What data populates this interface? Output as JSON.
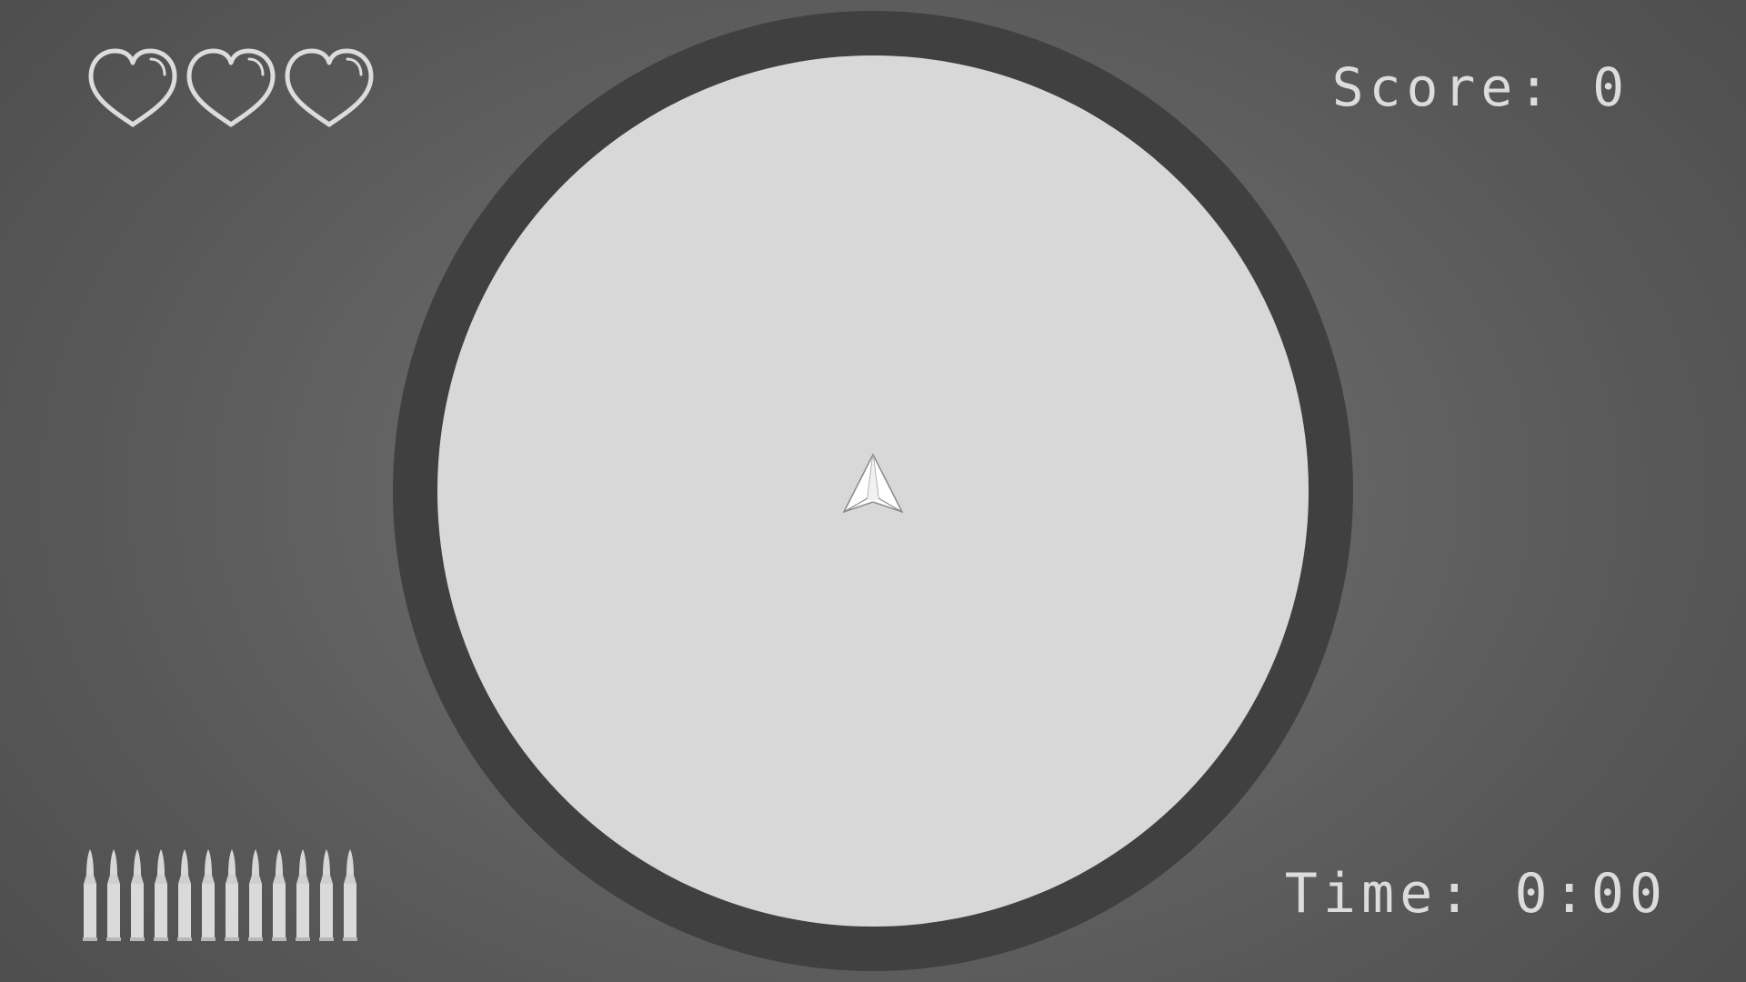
{
  "hud": {
    "score_label": "Score: 0",
    "time_label": "Time: 0:00"
  },
  "player": {
    "lives": 3,
    "ammo": 12
  },
  "colors": {
    "hud_text": "#dcdcdc",
    "arena_ring": "#404040",
    "arena_floor": "#d8d8d8",
    "ship_fill": "#ffffff",
    "ship_stroke": "#888888"
  },
  "icons": {
    "life": "heart-icon",
    "ammo": "bullet-icon",
    "player": "ship-icon"
  }
}
